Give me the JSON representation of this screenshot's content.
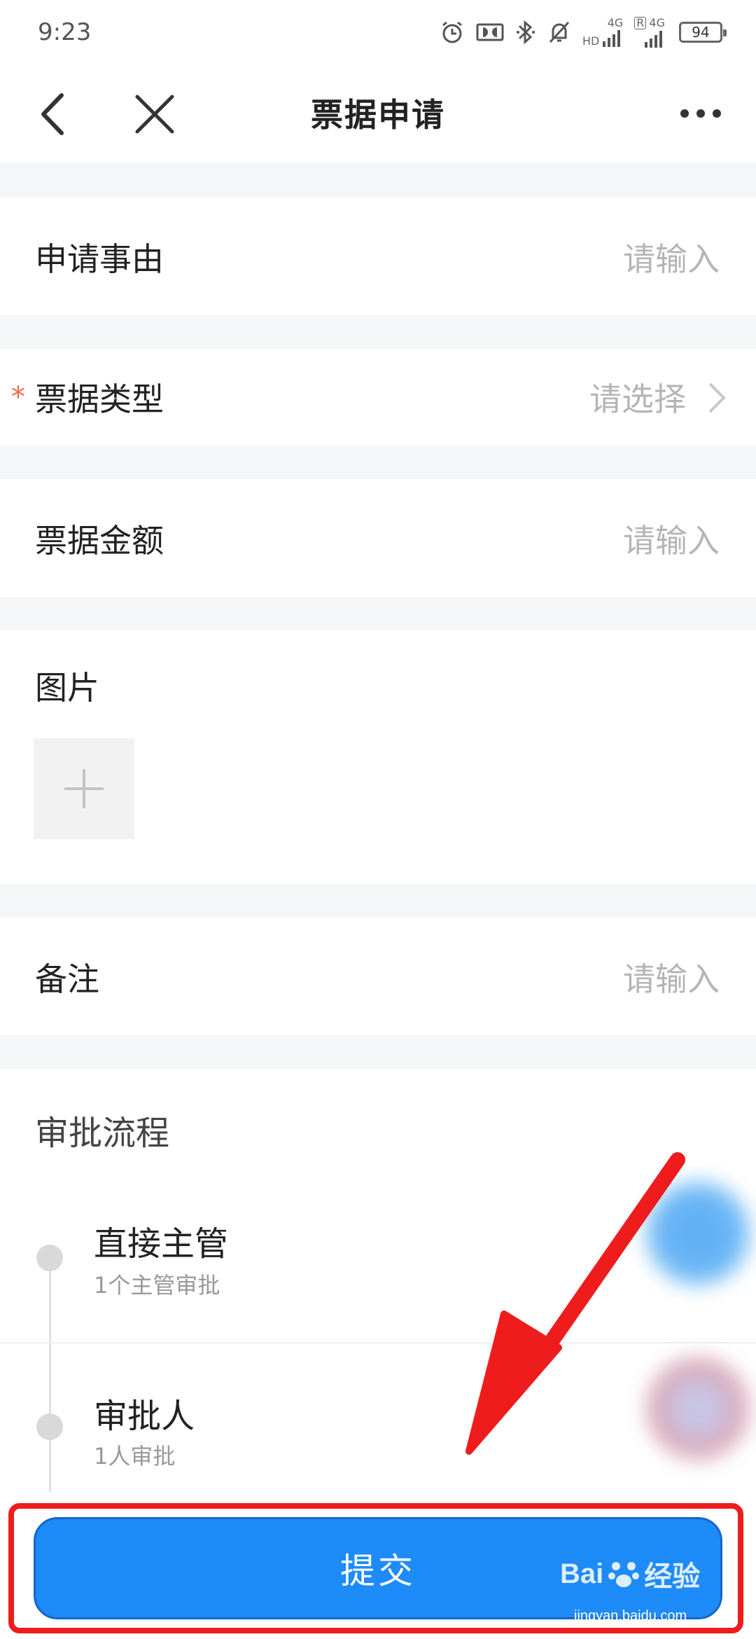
{
  "status_bar": {
    "time": "9:23",
    "battery": "94",
    "net_1": "4G",
    "net_2": "4G",
    "hd": "HD",
    "roaming": "R"
  },
  "nav": {
    "title": "票据申请"
  },
  "form": {
    "reason": {
      "label": "申请事由",
      "placeholder": "请输入"
    },
    "type": {
      "label": "票据类型",
      "placeholder": "请选择",
      "required_mark": "*"
    },
    "amount": {
      "label": "票据金额",
      "placeholder": "请输入"
    },
    "images": {
      "label": "图片"
    },
    "remark": {
      "label": "备注",
      "placeholder": "请输入"
    }
  },
  "approval": {
    "title": "审批流程",
    "steps": [
      {
        "name": "直接主管",
        "desc": "1个主管审批"
      },
      {
        "name": "审批人",
        "desc": "1人审批"
      }
    ]
  },
  "submit": {
    "label": "提交"
  },
  "watermark": {
    "brand": "Bai",
    "brand_end": "经验",
    "site": "jingyan.baidu.com"
  },
  "colors": {
    "accent": "#1d8bf8",
    "annotation_red": "#ee1c1c",
    "required": "#f06b49"
  }
}
